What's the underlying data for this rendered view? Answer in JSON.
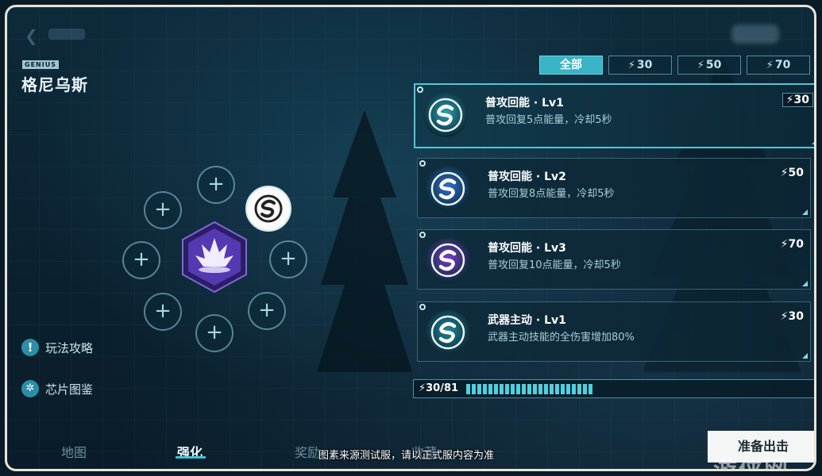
{
  "header": {
    "genius_tag": "GENIUS",
    "hero_name": "格尼乌斯"
  },
  "filters": [
    {
      "label": "全部",
      "active": true,
      "bolt": false
    },
    {
      "label": "30",
      "active": false,
      "bolt": true
    },
    {
      "label": "50",
      "active": false,
      "bolt": true
    },
    {
      "label": "70",
      "active": false,
      "bolt": true
    }
  ],
  "chips": [
    {
      "title": "普攻回能 · Lv1",
      "desc": "普攻回复5点能量，冷却5秒",
      "cost": "30",
      "color": "#2aa3b2",
      "selected": true
    },
    {
      "title": "普攻回能 · Lv2",
      "desc": "普攻回复8点能量，冷却5秒",
      "cost": "50",
      "color": "#2f6fd0",
      "selected": false
    },
    {
      "title": "普攻回能 · Lv3",
      "desc": "普攻回复10点能量，冷却5秒",
      "cost": "70",
      "color": "#7a3cc8",
      "selected": false
    },
    {
      "title": "武器主动 · Lv1",
      "desc": "武器主动技能的全伤害增加80%",
      "cost": "30",
      "color": "#1f8a9a",
      "selected": false
    }
  ],
  "energy": {
    "label": "30/81",
    "current": 30,
    "max": 81
  },
  "side_links": {
    "guide": "玩法攻略",
    "chip_book": "芯片图鉴"
  },
  "tabs": {
    "map": "地图",
    "enhance": "强化",
    "reward": "奖励",
    "collection": "收藏"
  },
  "notice": "图素来源测试服，请以正式服内容为准",
  "ready_button": "准备出击",
  "watermark": "游侠网",
  "colors": {
    "accent": "#39b3c6",
    "hero_purple": "#6a3cc8"
  }
}
